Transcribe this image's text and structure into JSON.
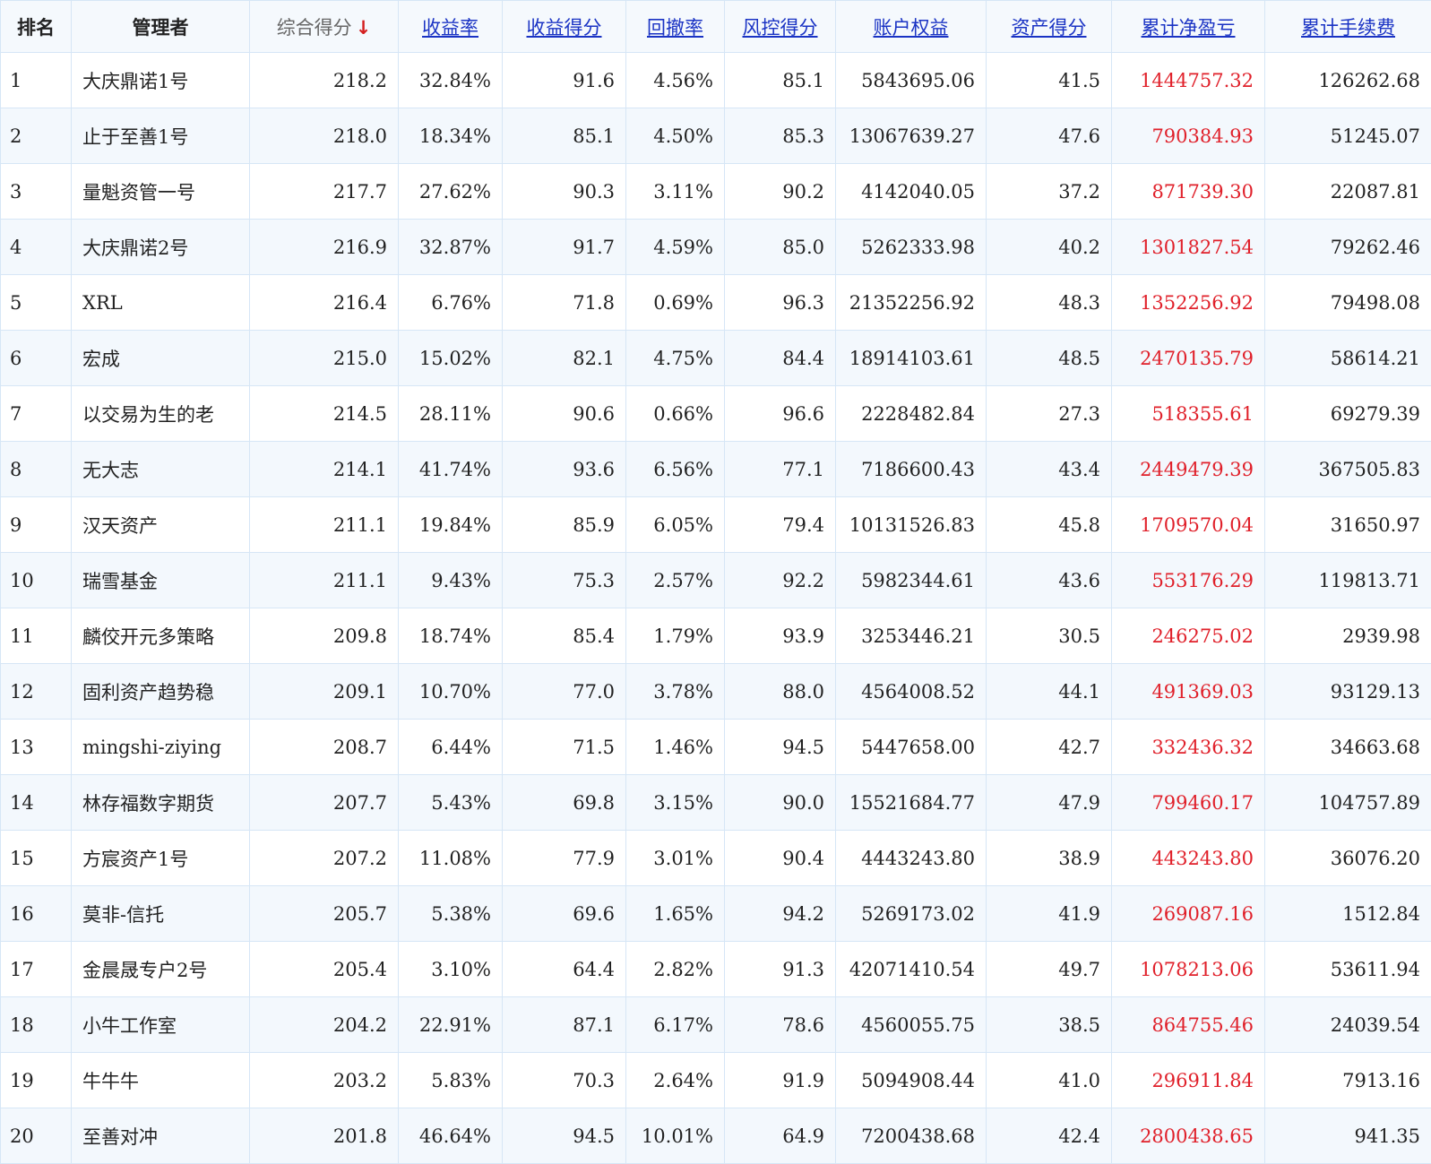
{
  "headers": {
    "rank": "排名",
    "manager": "管理者",
    "composite_score": "综合得分",
    "composite_arrow": "↓",
    "return_rate": "收益率",
    "return_score": "收益得分",
    "drawdown": "回撤率",
    "risk_score": "风控得分",
    "equity": "账户权益",
    "asset_score": "资产得分",
    "net_pnl": "累计净盈亏",
    "fees": "累计手续费"
  },
  "colors": {
    "header_link": "#1a33c4",
    "pnl": "#e0202a",
    "sort_arrow": "#d42020",
    "stripe": "#f3f8fd"
  },
  "rows": [
    [
      "1",
      "大庆鼎诺1号",
      "218.2",
      "32.84%",
      "91.6",
      "4.56%",
      "85.1",
      "5843695.06",
      "41.5",
      "1444757.32",
      "126262.68"
    ],
    [
      "2",
      "止于至善1号",
      "218.0",
      "18.34%",
      "85.1",
      "4.50%",
      "85.3",
      "13067639.27",
      "47.6",
      "790384.93",
      "51245.07"
    ],
    [
      "3",
      "量魁资管一号",
      "217.7",
      "27.62%",
      "90.3",
      "3.11%",
      "90.2",
      "4142040.05",
      "37.2",
      "871739.30",
      "22087.81"
    ],
    [
      "4",
      "大庆鼎诺2号",
      "216.9",
      "32.87%",
      "91.7",
      "4.59%",
      "85.0",
      "5262333.98",
      "40.2",
      "1301827.54",
      "79262.46"
    ],
    [
      "5",
      "XRL",
      "216.4",
      "6.76%",
      "71.8",
      "0.69%",
      "96.3",
      "21352256.92",
      "48.3",
      "1352256.92",
      "79498.08"
    ],
    [
      "6",
      "宏成",
      "215.0",
      "15.02%",
      "82.1",
      "4.75%",
      "84.4",
      "18914103.61",
      "48.5",
      "2470135.79",
      "58614.21"
    ],
    [
      "7",
      "以交易为生的老",
      "214.5",
      "28.11%",
      "90.6",
      "0.66%",
      "96.6",
      "2228482.84",
      "27.3",
      "518355.61",
      "69279.39"
    ],
    [
      "8",
      "无大志",
      "214.1",
      "41.74%",
      "93.6",
      "6.56%",
      "77.1",
      "7186600.43",
      "43.4",
      "2449479.39",
      "367505.83"
    ],
    [
      "9",
      "汉天资产",
      "211.1",
      "19.84%",
      "85.9",
      "6.05%",
      "79.4",
      "10131526.83",
      "45.8",
      "1709570.04",
      "31650.97"
    ],
    [
      "10",
      "瑞雪基金",
      "211.1",
      "9.43%",
      "75.3",
      "2.57%",
      "92.2",
      "5982344.61",
      "43.6",
      "553176.29",
      "119813.71"
    ],
    [
      "11",
      "麟佼开元多策略",
      "209.8",
      "18.74%",
      "85.4",
      "1.79%",
      "93.9",
      "3253446.21",
      "30.5",
      "246275.02",
      "2939.98"
    ],
    [
      "12",
      "固利资产趋势稳",
      "209.1",
      "10.70%",
      "77.0",
      "3.78%",
      "88.0",
      "4564008.52",
      "44.1",
      "491369.03",
      "93129.13"
    ],
    [
      "13",
      "mingshi-ziying",
      "208.7",
      "6.44%",
      "71.5",
      "1.46%",
      "94.5",
      "5447658.00",
      "42.7",
      "332436.32",
      "34663.68"
    ],
    [
      "14",
      "林存福数字期货",
      "207.7",
      "5.43%",
      "69.8",
      "3.15%",
      "90.0",
      "15521684.77",
      "47.9",
      "799460.17",
      "104757.89"
    ],
    [
      "15",
      "方宸资产1号",
      "207.2",
      "11.08%",
      "77.9",
      "3.01%",
      "90.4",
      "4443243.80",
      "38.9",
      "443243.80",
      "36076.20"
    ],
    [
      "16",
      "莫非-信托",
      "205.7",
      "5.38%",
      "69.6",
      "1.65%",
      "94.2",
      "5269173.02",
      "41.9",
      "269087.16",
      "1512.84"
    ],
    [
      "17",
      "金晨晟专户2号",
      "205.4",
      "3.10%",
      "64.4",
      "2.82%",
      "91.3",
      "42071410.54",
      "49.7",
      "1078213.06",
      "53611.94"
    ],
    [
      "18",
      "小牛工作室",
      "204.2",
      "22.91%",
      "87.1",
      "6.17%",
      "78.6",
      "4560055.75",
      "38.5",
      "864755.46",
      "24039.54"
    ],
    [
      "19",
      "牛牛牛",
      "203.2",
      "5.83%",
      "70.3",
      "2.64%",
      "91.9",
      "5094908.44",
      "41.0",
      "296911.84",
      "7913.16"
    ],
    [
      "20",
      "至善对冲",
      "201.8",
      "46.64%",
      "94.5",
      "10.01%",
      "64.9",
      "7200438.68",
      "42.4",
      "2800438.65",
      "941.35"
    ]
  ]
}
